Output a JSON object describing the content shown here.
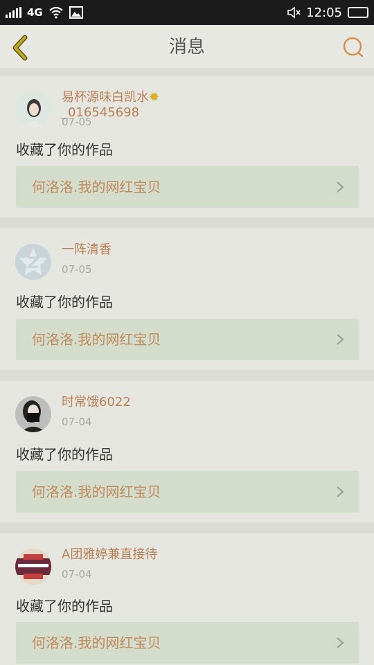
{
  "status_bar": {
    "network": "4G",
    "time": "12:05"
  },
  "header": {
    "title": "消息"
  },
  "messages": [
    {
      "username": "易杯源味白凯水",
      "username_line2": "_016545698",
      "date": "07-05",
      "action": "收藏了你的作品",
      "work_title": "何洛洛.我的网红宝贝"
    },
    {
      "username": "一阵清香",
      "date": "07-05",
      "action": "收藏了你的作品",
      "work_title": "何洛洛.我的网红宝贝"
    },
    {
      "username": "时常饿6022",
      "date": "07-04",
      "action": "收藏了你的作品",
      "work_title": "何洛洛.我的网红宝贝"
    },
    {
      "username": "A团雅婷兼直接待",
      "date": "07-04",
      "action": "收藏了你的作品",
      "work_title": "何洛洛.我的网红宝贝"
    }
  ],
  "colors": {
    "accent": "#c08a5d",
    "back_arrow": "#c2a81e",
    "search_icon": "#d5904f"
  }
}
